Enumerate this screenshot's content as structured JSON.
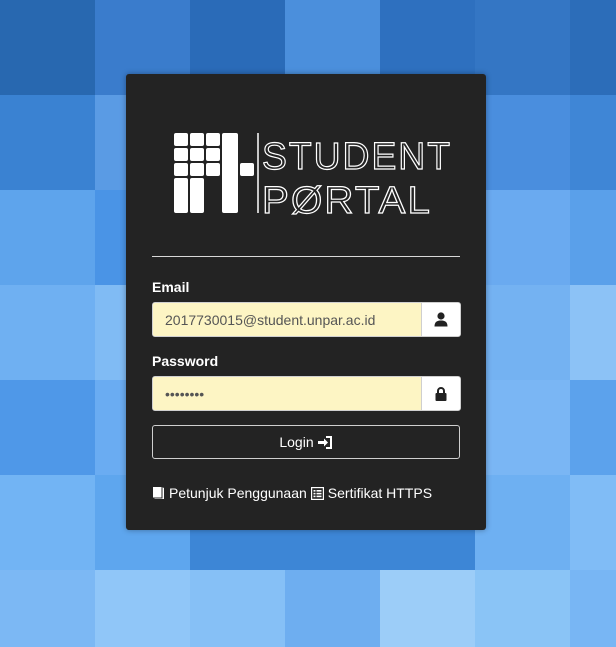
{
  "app": {
    "title_line1": "STUDENT",
    "title_line2": "PØRTAL"
  },
  "colors": {
    "accent_background": "#3d86d6",
    "card": "#232323",
    "input_fill": "#fdf5c4"
  },
  "form": {
    "email_label": "Email",
    "email_value": "2017730015@student.unpar.ac.id",
    "email_icon": "user-icon",
    "password_label": "Password",
    "password_value": "abcdefgh",
    "password_icon": "lock-icon",
    "login_label": "Login",
    "login_icon": "sign-in-icon"
  },
  "links": [
    {
      "label": "Petunjuk Penggunaan",
      "icon": "book-icon"
    },
    {
      "label": "Sertifikat HTTPS",
      "icon": "list-alt-icon"
    }
  ]
}
